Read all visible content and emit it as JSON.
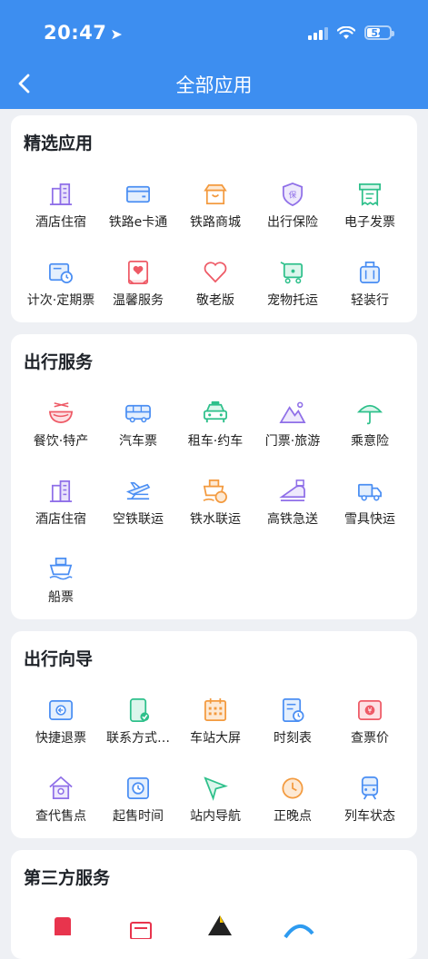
{
  "status": {
    "time": "20:47",
    "battery": "54"
  },
  "header": {
    "title": "全部应用"
  },
  "sections": [
    {
      "title": "精选应用",
      "items": [
        {
          "label": "酒店住宿",
          "icon": "building-icon"
        },
        {
          "label": "铁路e卡通",
          "icon": "card-icon"
        },
        {
          "label": "铁路商城",
          "icon": "shop-icon"
        },
        {
          "label": "出行保险",
          "icon": "shield-icon"
        },
        {
          "label": "电子发票",
          "icon": "invoice-icon"
        },
        {
          "label": "计次·定期票",
          "icon": "ticket-clock-icon"
        },
        {
          "label": "温馨服务",
          "icon": "heart-doc-icon"
        },
        {
          "label": "敬老版",
          "icon": "heart-icon"
        },
        {
          "label": "宠物托运",
          "icon": "pet-cart-icon"
        },
        {
          "label": "轻装行",
          "icon": "luggage-icon"
        }
      ]
    },
    {
      "title": "出行服务",
      "items": [
        {
          "label": "餐饮·特产",
          "icon": "noodle-bowl-icon"
        },
        {
          "label": "汽车票",
          "icon": "bus-icon"
        },
        {
          "label": "租车·约车",
          "icon": "taxi-icon"
        },
        {
          "label": "门票·旅游",
          "icon": "mountain-icon"
        },
        {
          "label": "乘意险",
          "icon": "umbrella-icon"
        },
        {
          "label": "酒店住宿",
          "icon": "building-icon"
        },
        {
          "label": "空铁联运",
          "icon": "plane-train-icon"
        },
        {
          "label": "铁水联运",
          "icon": "ship-train-icon"
        },
        {
          "label": "高铁急送",
          "icon": "bullet-train-icon"
        },
        {
          "label": "雪具快运",
          "icon": "truck-icon"
        },
        {
          "label": "船票",
          "icon": "ship-icon"
        }
      ]
    },
    {
      "title": "出行向导",
      "items": [
        {
          "label": "快捷退票",
          "icon": "refund-ticket-icon"
        },
        {
          "label": "联系方式…",
          "icon": "phone-check-icon"
        },
        {
          "label": "车站大屏",
          "icon": "calendar-grid-icon"
        },
        {
          "label": "时刻表",
          "icon": "timetable-icon"
        },
        {
          "label": "查票价",
          "icon": "price-ticket-icon"
        },
        {
          "label": "查代售点",
          "icon": "house-icon"
        },
        {
          "label": "起售时间",
          "icon": "clock-ticket-icon"
        },
        {
          "label": "站内导航",
          "icon": "navigation-arrow-icon"
        },
        {
          "label": "正晚点",
          "icon": "clock-icon"
        },
        {
          "label": "列车状态",
          "icon": "train-icon"
        }
      ]
    },
    {
      "title": "第三方服务",
      "items": []
    }
  ]
}
